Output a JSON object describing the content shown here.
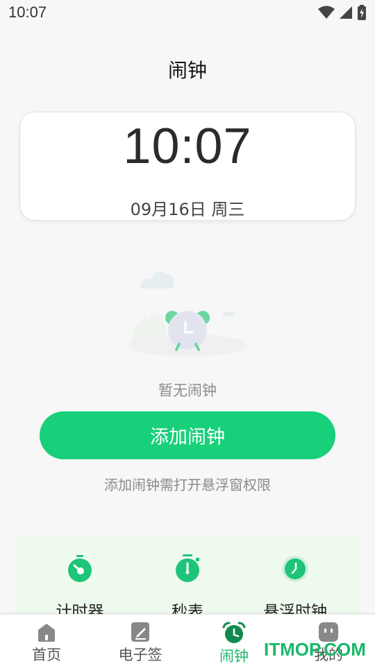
{
  "status_bar": {
    "time": "10:07",
    "icons": [
      "wifi-icon",
      "signal-icon",
      "battery-charging-icon"
    ]
  },
  "header": {
    "title": "闹钟"
  },
  "clock": {
    "time": "10:07",
    "date": "09月16日 周三"
  },
  "empty_state": {
    "message": "暂无闹钟",
    "illustration": "alarm-clock-illustration"
  },
  "actions": {
    "add_alarm_label": "添加闹钟",
    "permission_hint": "添加闹钟需打开悬浮窗权限"
  },
  "tools": [
    {
      "label": "计时器",
      "icon": "timer-icon"
    },
    {
      "label": "秒表",
      "icon": "stopwatch-icon"
    },
    {
      "label": "悬浮时钟",
      "icon": "floating-clock-icon"
    }
  ],
  "bottom_nav": [
    {
      "label": "首页",
      "icon": "home-icon",
      "active": false
    },
    {
      "label": "电子签",
      "icon": "sign-icon",
      "active": false
    },
    {
      "label": "闹钟",
      "icon": "alarm-icon",
      "active": true
    },
    {
      "label": "我的",
      "icon": "profile-icon",
      "active": false
    }
  ],
  "colors": {
    "accent": "#19d07a",
    "active_nav": "#19b86c",
    "tool_bg": "#effaee"
  },
  "watermark": {
    "text": "ITMOP.COM"
  }
}
